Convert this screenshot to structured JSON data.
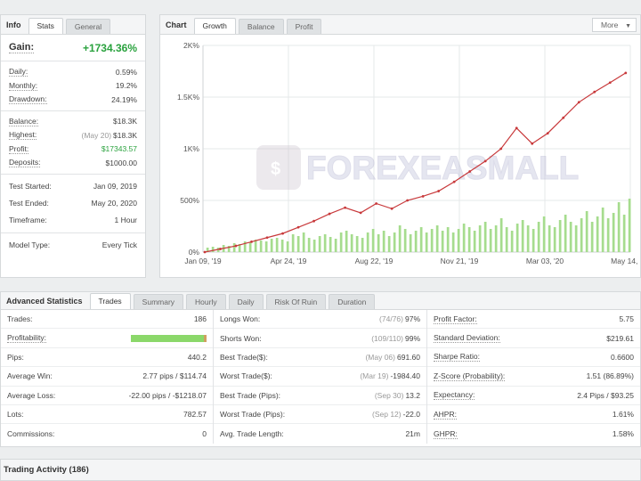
{
  "info": {
    "title": "Info",
    "tabs": [
      "Stats",
      "General"
    ],
    "gain_label": "Gain:",
    "gain_value": "+1734.36%",
    "rows": [
      {
        "label": "Daily:",
        "value": "0.59%"
      },
      {
        "label": "Monthly:",
        "value": "19.2%"
      },
      {
        "label": "Drawdown:",
        "value": "24.19%"
      },
      {
        "label": "Balance:",
        "value": "$18.3K"
      },
      {
        "label": "Highest:",
        "sub": "(May 20)",
        "value": "$18.3K"
      },
      {
        "label": "Profit:",
        "value": "$17343.57"
      },
      {
        "label": "Deposits:",
        "value": "$1000.00"
      },
      {
        "label": "Test Started:",
        "value": "Jan 09, 2019"
      },
      {
        "label": "Test Ended:",
        "value": "May 20, 2020"
      },
      {
        "label": "Timeframe:",
        "value": "1 Hour"
      },
      {
        "label": "Model Type:",
        "value": "Every Tick"
      }
    ]
  },
  "chart": {
    "title": "Chart",
    "tabs": [
      "Growth",
      "Balance",
      "Profit"
    ],
    "more_label": "More",
    "watermark": "FOREXEASMALL",
    "y_ticks": [
      "2K%",
      "1.5K%",
      "1K%",
      "500%",
      "0%"
    ],
    "x_ticks": [
      "Jan 09, '19",
      "Apr 24, '19",
      "Aug 22, '19",
      "Nov 21, '19",
      "Mar 03, '20",
      "May 14, '20"
    ]
  },
  "chart_data": {
    "type": "line",
    "title": "",
    "xlabel": "",
    "ylabel": "",
    "ylim": [
      0,
      2000
    ],
    "grid": true,
    "series": [
      {
        "kind": "line",
        "color": "#c8393b",
        "x": [
          "Jan 09, '19",
          "Feb 01, '19",
          "Mar 01, '19",
          "Apr 01, '19",
          "Apr 24, '19",
          "May 20, '19",
          "Jun 15, '19",
          "Jul 10, '19",
          "Aug 01, '19",
          "Aug 22, '19",
          "Sep 05, '19",
          "Sep 20, '19",
          "Oct 05, '19",
          "Oct 20, '19",
          "Nov 05, '19",
          "Nov 21, '19",
          "Dec 10, '19",
          "Jan 01, '20",
          "Jan 20, '20",
          "Feb 05, '20",
          "Feb 20, '20",
          "Mar 03, '20",
          "Mar 19, '20",
          "Apr 01, '20",
          "Apr 15, '20",
          "May 01, '20",
          "May 14, '20",
          "May 20, '20"
        ],
        "y": [
          0,
          30,
          60,
          100,
          140,
          180,
          240,
          300,
          370,
          430,
          380,
          470,
          420,
          500,
          540,
          590,
          680,
          780,
          880,
          1000,
          1200,
          1050,
          1150,
          1300,
          1450,
          1550,
          1640,
          1734
        ]
      },
      {
        "kind": "bar",
        "color": "#a6dc8e",
        "values": [
          5,
          6,
          5,
          8,
          7,
          10,
          9,
          12,
          11,
          14,
          13,
          12,
          15,
          16,
          14,
          12,
          20,
          18,
          22,
          16,
          14,
          18,
          20,
          17,
          15,
          22,
          24,
          20,
          18,
          16,
          22,
          26,
          20,
          24,
          18,
          22,
          30,
          26,
          20,
          24,
          28,
          22,
          26,
          30,
          24,
          28,
          22,
          26,
          32,
          28,
          24,
          30,
          34,
          26,
          30,
          38,
          28,
          24,
          32,
          36,
          30,
          26,
          34,
          40,
          30,
          28,
          36,
          42,
          34,
          30,
          38,
          46,
          34,
          40,
          50,
          38,
          44,
          56,
          42,
          60
        ]
      }
    ]
  },
  "advanced": {
    "title": "Advanced Statistics",
    "tabs": [
      "Trades",
      "Summary",
      "Hourly",
      "Daily",
      "Risk Of Ruin",
      "Duration"
    ],
    "col1": [
      {
        "label": "Trades:",
        "value": "186"
      },
      {
        "label": "Profitability:",
        "bar": true,
        "dotted": true
      },
      {
        "label": "Pips:",
        "value": "440.2"
      },
      {
        "label": "Average Win:",
        "value": "2.77 pips / $114.74"
      },
      {
        "label": "Average Loss:",
        "value": "-22.00 pips / -$1218.07"
      },
      {
        "label": "Lots:",
        "value": "782.57"
      },
      {
        "label": "Commissions:",
        "value": "0"
      }
    ],
    "col2": [
      {
        "label": "Longs Won:",
        "sub": "(74/76)",
        "value": "97%"
      },
      {
        "label": "Shorts Won:",
        "sub": "(109/110)",
        "value": "99%"
      },
      {
        "label": "Best Trade($):",
        "sub": "(May 06)",
        "value": "691.60"
      },
      {
        "label": "Worst Trade($):",
        "sub": "(Mar 19)",
        "value": "-1984.40"
      },
      {
        "label": "Best Trade (Pips):",
        "sub": "(Sep 30)",
        "value": "13.2"
      },
      {
        "label": "Worst Trade (Pips):",
        "sub": "(Sep 12)",
        "value": "-22.0"
      },
      {
        "label": "Avg. Trade Length:",
        "value": "21m"
      }
    ],
    "col3": [
      {
        "label": "Profit Factor:",
        "value": "5.75",
        "dotted": true
      },
      {
        "label": "Standard Deviation:",
        "value": "$219.61",
        "dotted": true
      },
      {
        "label": "Sharpe Ratio:",
        "value": "0.6600",
        "dotted": true
      },
      {
        "label": "Z-Score (Probability):",
        "value": "1.51 (86.89%)",
        "dotted": true
      },
      {
        "label": "Expectancy:",
        "value": "2.4 Pips / $93.25",
        "dotted": true
      },
      {
        "label": "AHPR:",
        "value": "1.61%",
        "dotted": true
      },
      {
        "label": "GHPR:",
        "value": "1.58%",
        "dotted": true
      }
    ]
  },
  "activity": {
    "title": "Trading Activity (186)"
  }
}
